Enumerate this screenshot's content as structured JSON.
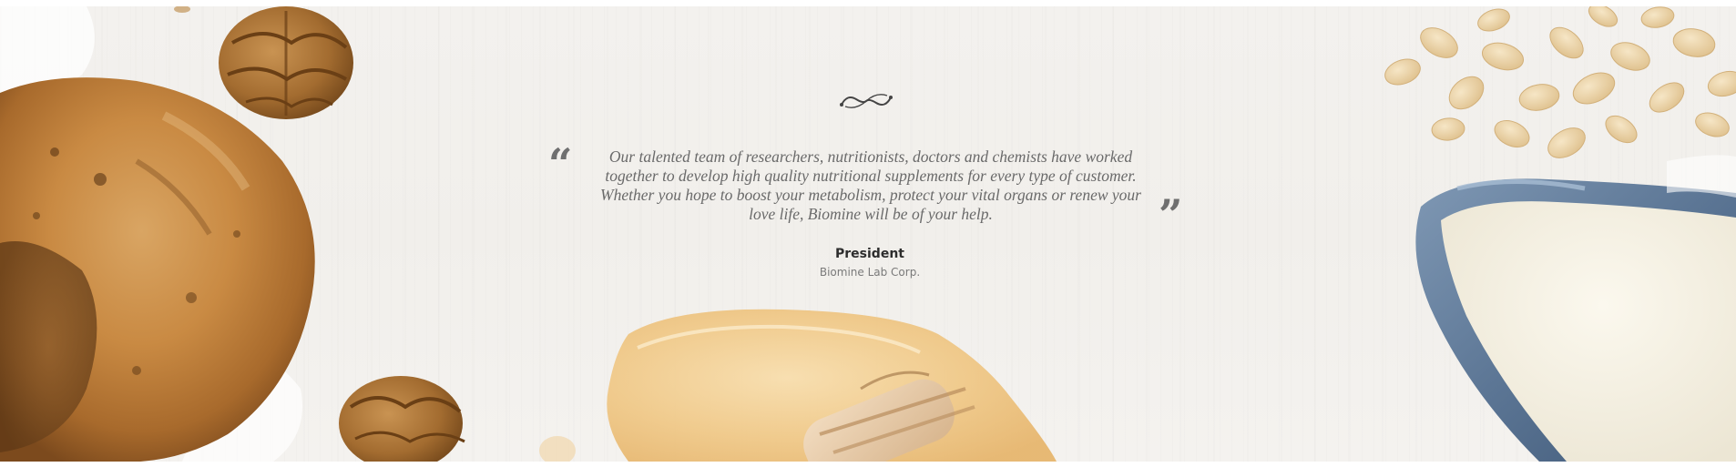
{
  "testimonial": {
    "quote": "Our talented team of researchers, nutritionists, doctors and chemists have worked together to develop high quality nutritional supplements for every type of customer. Whether you hope to boost your metabolism, protect your vital organs or renew your love life, Biomine will be of your help.",
    "open_mark": "“",
    "close_mark": "”",
    "author_title": "President",
    "author_company": "Biomine Lab Corp."
  },
  "background": {
    "photo_items": [
      "bread-loaf",
      "walnut",
      "walnut",
      "oat-flakes",
      "milk-jug",
      "honey-spill",
      "honey-dipper"
    ],
    "colors": {
      "backdrop": "#f2f0ec",
      "quote_text": "#6a6a6a",
      "quote_marks": "#6f6f6f",
      "author_title": "#2d2d2d",
      "author_company": "#7a7a7a"
    }
  },
  "icons": {
    "ornament": "flourish-divider-icon"
  }
}
